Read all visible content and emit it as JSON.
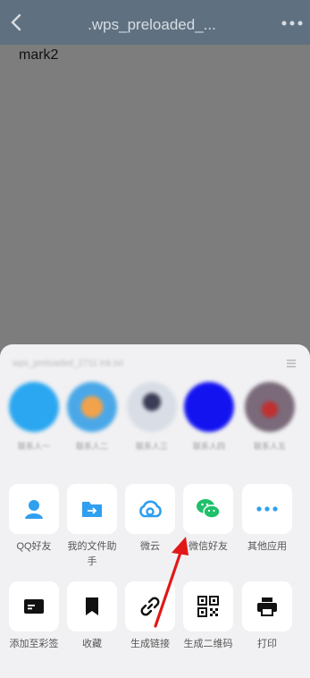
{
  "header": {
    "title": ".wps_preloaded_...",
    "back_icon": "chevron-left-icon",
    "more_icon": "more-dots-icon",
    "bar_color": "#5f7080"
  },
  "document": {
    "text": "mark2"
  },
  "share_sheet": {
    "header_text": "wps_preloaded_2711 ink.txt",
    "recent_contacts": [
      {
        "name": "联系人一",
        "color": "#2aa7f0"
      },
      {
        "name": "联系人二",
        "color": "#4aa8e8"
      },
      {
        "name": "联系人三",
        "color": "#d8dde6"
      },
      {
        "name": "联系人四",
        "color": "#1313f0"
      },
      {
        "name": "联系人五",
        "color": "#7a6a7a"
      }
    ],
    "apps": [
      {
        "label": "QQ好友",
        "icon": "qq-user-icon"
      },
      {
        "label": "我的文件助手",
        "icon": "file-transfer-icon"
      },
      {
        "label": "微云",
        "icon": "weiyun-cloud-icon"
      },
      {
        "label": "微信好友",
        "icon": "wechat-icon"
      },
      {
        "label": "其他应用",
        "icon": "more-apps-icon"
      }
    ],
    "actions": [
      {
        "label": "添加至彩签",
        "icon": "tag-card-icon"
      },
      {
        "label": "收藏",
        "icon": "bookmark-icon"
      },
      {
        "label": "生成链接",
        "icon": "link-icon"
      },
      {
        "label": "生成二维码",
        "icon": "qrcode-icon"
      },
      {
        "label": "打印",
        "icon": "printer-icon"
      }
    ]
  },
  "annotation": {
    "arrow_color": "#e01818"
  }
}
